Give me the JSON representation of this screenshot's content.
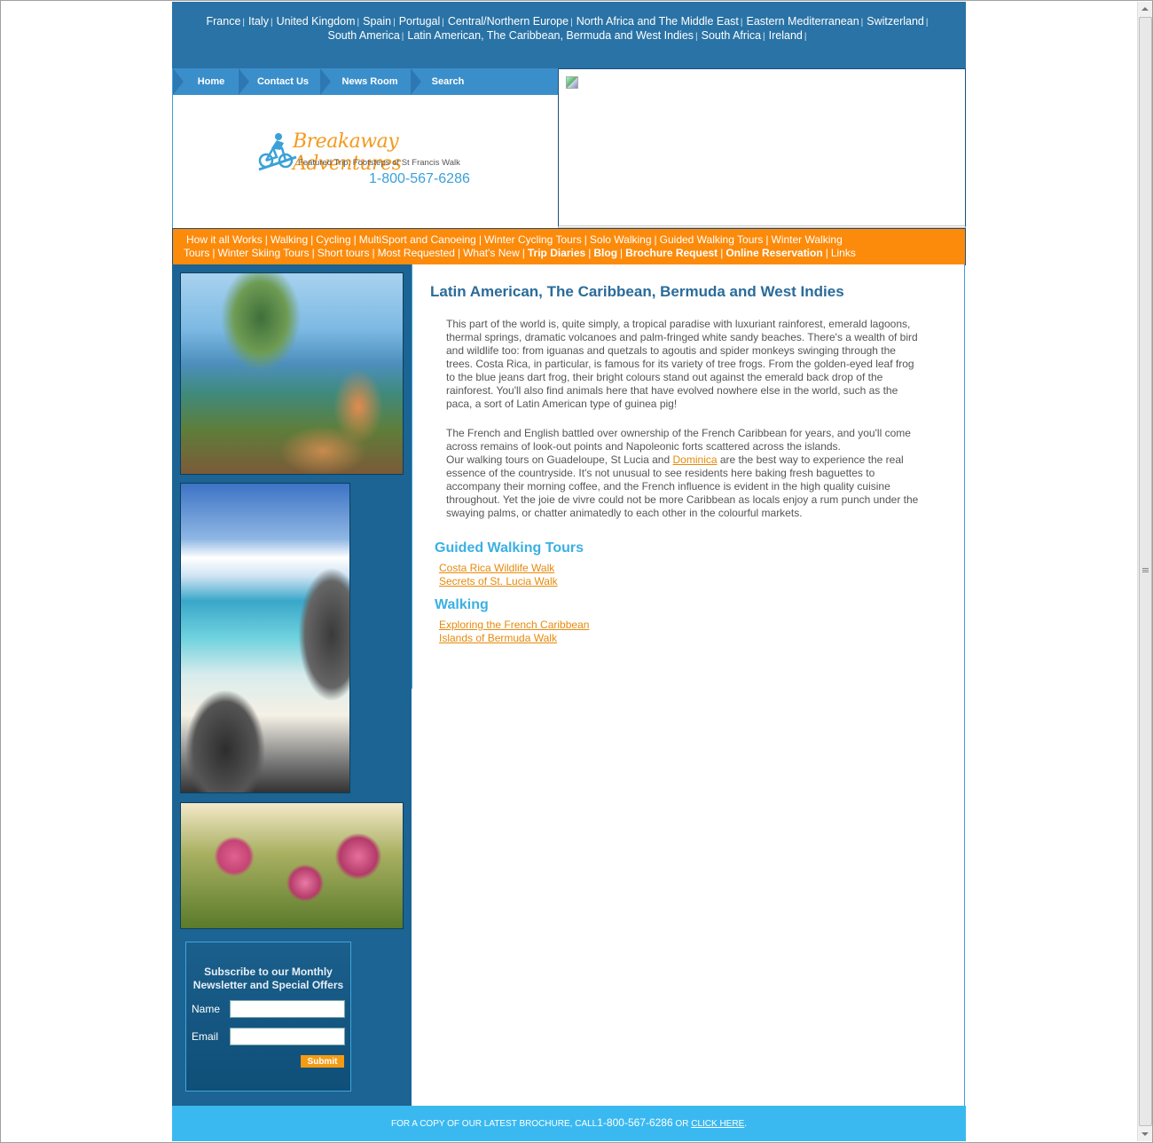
{
  "region_nav": [
    {
      "label": "France"
    },
    {
      "label": "Italy"
    },
    {
      "label": "United Kingdom"
    },
    {
      "label": "Spain"
    },
    {
      "label": "Portugal"
    },
    {
      "label": "Central/Northern Europe"
    },
    {
      "label": "North Africa and The Middle East"
    },
    {
      "label": "Eastern Mediterranean"
    },
    {
      "label": "Switzerland"
    },
    {
      "label": "South America"
    },
    {
      "label": "Latin American, The Caribbean, Bermuda and West Indies"
    },
    {
      "label": "South Africa"
    },
    {
      "label": "Ireland"
    }
  ],
  "separator": "|",
  "main_nav": {
    "home": "Home",
    "contact": "Contact Us",
    "news": "News Room",
    "search": "Search"
  },
  "logo": {
    "title": "Breakaway Adventures",
    "featured": "Featured Trip: Footsteps of St Francis Walk",
    "phone": "1-800-567-6286"
  },
  "activity_nav": {
    "items": [
      {
        "label": "How it all Works",
        "bold": false
      },
      {
        "label": "Walking",
        "bold": false
      },
      {
        "label": "Cycling",
        "bold": false
      },
      {
        "label": "MultiSport and Canoeing",
        "bold": false
      },
      {
        "label": "Winter Cycling Tours",
        "bold": false
      },
      {
        "label": "Solo Walking",
        "bold": false
      },
      {
        "label": "Guided Walking Tours",
        "bold": false
      },
      {
        "label": "Winter Walking Tours",
        "bold": false
      },
      {
        "label": "Winter Skiing Tours",
        "bold": false
      },
      {
        "label": "Short tours",
        "bold": false
      },
      {
        "label": "Most Requested",
        "bold": false
      },
      {
        "label": "What's New",
        "bold": false
      },
      {
        "label": "Trip Diaries",
        "bold": true
      },
      {
        "label": "Blog",
        "bold": true
      },
      {
        "label": "Brochure Request",
        "bold": true
      },
      {
        "label": "Online Reservation",
        "bold": true
      },
      {
        "label": "Links",
        "bold": false
      }
    ]
  },
  "subscribe": {
    "title": "Subscribe to our Monthly Newsletter and Special Offers",
    "name_label": "Name",
    "email_label": "Email",
    "name_value": "",
    "email_value": "",
    "submit_label": "Submit"
  },
  "content": {
    "title": "Latin American, The Caribbean, Bermuda and West Indies",
    "para1": "This part of the world is, quite simply, a tropical paradise with luxuriant rainforest, emerald lagoons, thermal springs, dramatic volcanoes and palm-fringed white sandy beaches. There's a wealth of bird and wildlife too: from iguanas and quetzals to agoutis and spider monkeys swinging through the trees. Costa Rica, in particular, is famous for its variety of tree frogs. From the golden-eyed leaf frog to the blue jeans dart frog, their bright colours stand out against the emerald back drop of the rainforest. You'll also find animals here that have evolved nowhere else in the world, such as the paca, a sort of Latin American type of guinea pig!",
    "para2_a": "The French and English battled over ownership of the French Caribbean for years, and you'll come across remains of look-out points and Napoleonic forts scattered across the islands.",
    "para2_b": "Our walking tours on Guadeloupe, St Lucia and",
    "para2_link": "Dominica",
    "para2_c": "are the best way to experience the real essence of the countryside. It's not unusual to see residents here baking fresh baguettes to accompany their morning coffee, and the French influence is evident in the high quality cuisine throughout. Yet the joie de vivre could not be more Caribbean as locals enjoy a rum punch under the swaying palms, or chatter animatedly to each other in the colourful markets.",
    "guided_heading": "Guided Walking Tours",
    "guided_links": [
      "Costa Rica Wildlife Walk",
      "Secrets of St. Lucia Walk"
    ],
    "walking_heading": "Walking",
    "walking_links": [
      "Exploring the French Caribbean",
      "Islands of Bermuda Walk"
    ]
  },
  "footer": {
    "prefix": "FOR A COPY OF OUR LATEST BROCHURE, CALL",
    "phone": "1-800-567-6286",
    "or": " OR ",
    "link": "CLICK HERE",
    "suffix": "."
  },
  "colors": {
    "brand_blue": "#2a73a6",
    "accent_orange": "#fc8b0b",
    "footer_blue": "#3ab9f0",
    "link_orange": "#e68a0c"
  }
}
